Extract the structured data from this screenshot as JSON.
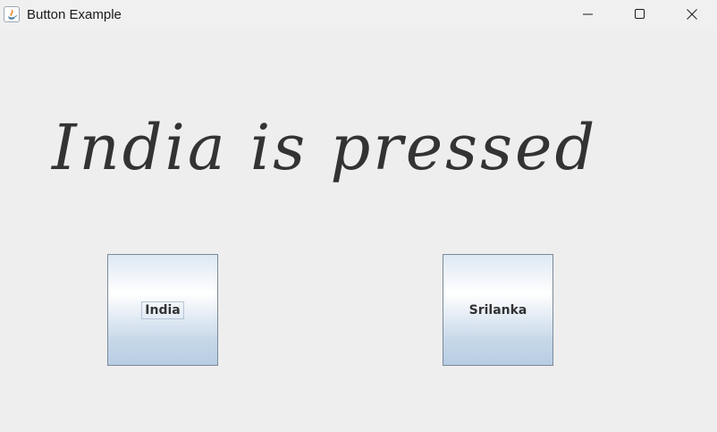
{
  "window": {
    "title": "Button Example",
    "icon": "java-icon"
  },
  "controls": {
    "minimize_icon": "minimize-icon",
    "maximize_icon": "maximize-icon",
    "close_icon": "close-icon"
  },
  "main": {
    "status_text": "India is pressed",
    "buttons": [
      {
        "label": "India",
        "focused": true
      },
      {
        "label": "Srilanka",
        "focused": false
      }
    ]
  }
}
